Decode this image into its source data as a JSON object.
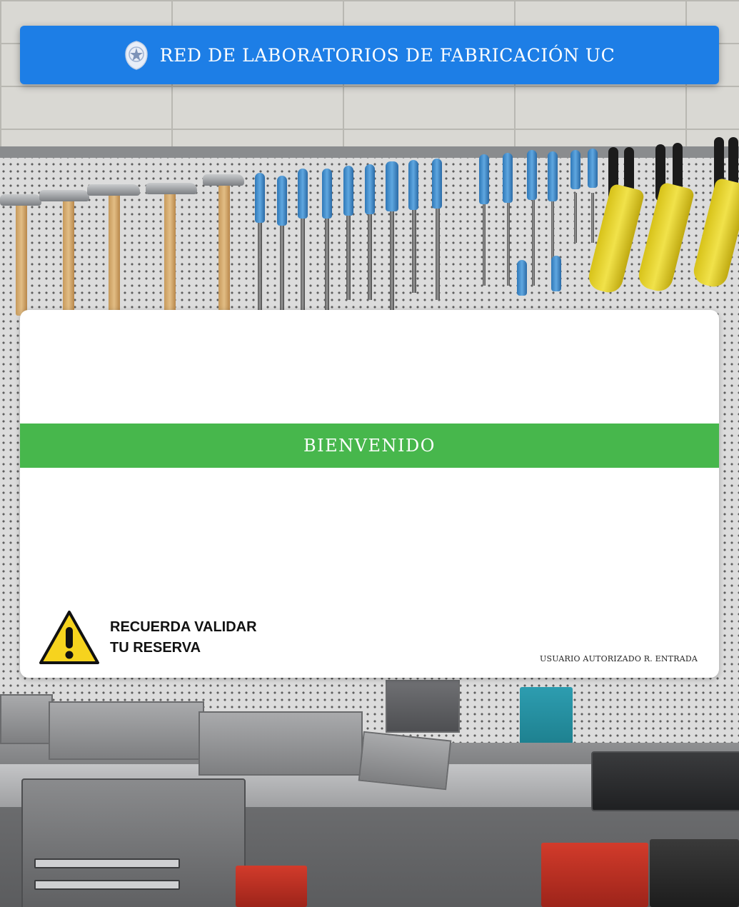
{
  "header": {
    "title": "RED DE LABORATORIOS DE FABRICACIÓN UC",
    "seal_icon": "university-seal-icon",
    "background_color": "#1d7ee6"
  },
  "card": {
    "welcome_text": "BIENVENIDO",
    "welcome_band_color": "#47b74c",
    "warning": {
      "icon": "warning-triangle-icon",
      "line1": "RECUERDA VALIDAR",
      "line2": "TU RESERVA"
    },
    "status_text": "USUARIO AUTORIZADO R. ENTRADA"
  }
}
